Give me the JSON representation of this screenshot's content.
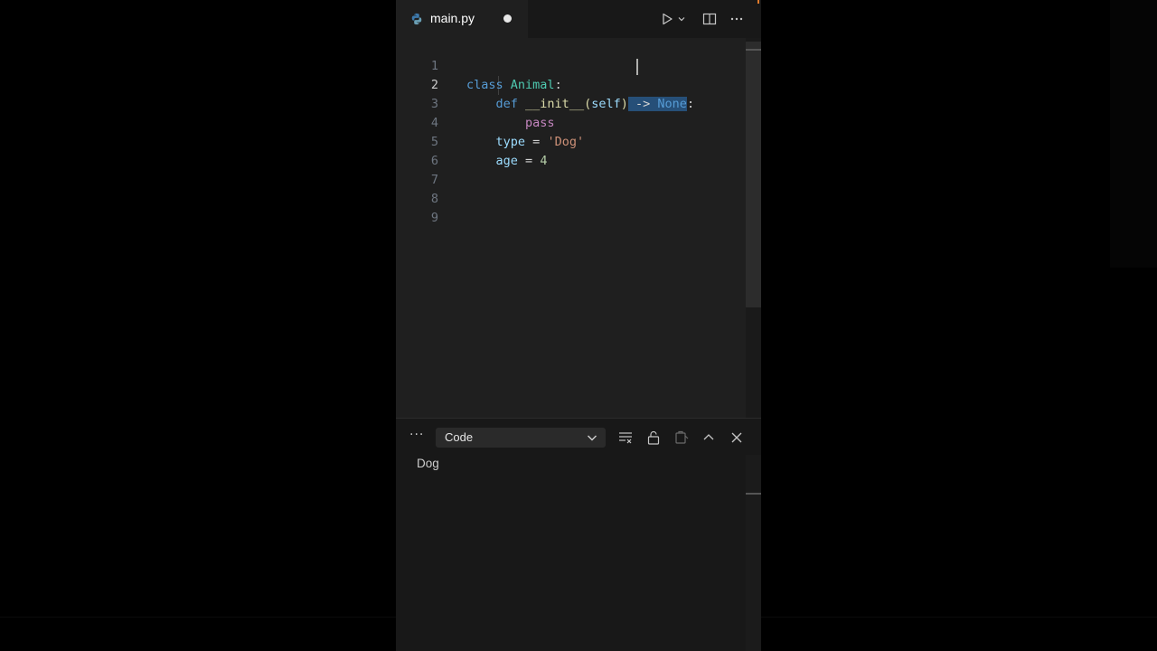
{
  "tab": {
    "filename": "main.py",
    "icon": "python-file-icon"
  },
  "toolbar": {
    "run_icon": "play-icon",
    "run_menu_icon": "chevron-down-icon",
    "split_icon": "split-editor-icon",
    "more_icon": "ellipsis-icon"
  },
  "editor": {
    "active_line": 2,
    "lines": [
      {
        "n": "1"
      },
      {
        "n": "2"
      },
      {
        "n": "3"
      },
      {
        "n": "4"
      },
      {
        "n": "5"
      },
      {
        "n": "6"
      },
      {
        "n": "7"
      },
      {
        "n": "8"
      },
      {
        "n": "9"
      }
    ],
    "tokens": {
      "l1": {
        "kw": "class",
        "name": "Animal",
        "colon": ":"
      },
      "l2": {
        "kw": "def",
        "fn": "__init__",
        "open": "(",
        "param": "self",
        "close": ")",
        "arrow": "->",
        "none": "None",
        "colon": ":"
      },
      "l3": {
        "kw": "pass"
      },
      "l4": {
        "var": "type",
        "eq": "=",
        "str": "'Dog'"
      },
      "l5": {
        "var": "age",
        "eq": "=",
        "num": "4"
      }
    }
  },
  "panel": {
    "more": "···",
    "select_value": "Code",
    "output": "Dog",
    "icons": [
      "clear-output-icon",
      "lock-icon",
      "copy-icon",
      "maximize-icon",
      "close-icon"
    ]
  },
  "colors": {
    "keyword": "#569cd6",
    "class": "#4ec9b0",
    "function": "#dcdcaa",
    "param": "#9cdcfe",
    "control": "#c586c0",
    "string": "#ce9178",
    "number": "#b5cea8",
    "selection": "#264f78"
  }
}
